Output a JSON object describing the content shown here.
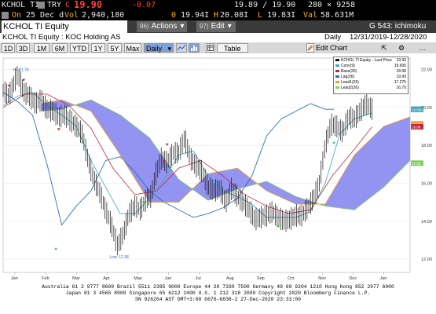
{
  "colors": {
    "bg": "#000000",
    "cloud": "#8080ee",
    "conv": "#3aa8b8",
    "base": "#c0283a",
    "lag": "#2a6fc0",
    "lead1": "#f0a030",
    "lead2": "#80d060",
    "price": "#111111",
    "quote_red": "#ff4040",
    "quote_amber": "#f0b030",
    "quote_white": "#e8e8e8"
  },
  "quote": {
    "ticker": "KCHOL TI",
    "currency": "TRY",
    "change_marker": "C",
    "last": "19.90",
    "change": "-0.07",
    "range": "19.89 / 19.90",
    "size": "280 × 9258",
    "as_of_label": "On",
    "date": "25 Dec d",
    "volume_label": "Vol",
    "volume": "2,940,180",
    "open_marker": "0",
    "open": "19.94I",
    "high_marker": "H",
    "high": "20.08I",
    "low_marker": "L",
    "low": "19.83I",
    "valuation_marker": "Val",
    "valuation": "58.631M"
  },
  "titlebar": {
    "security": "KCHOL TI Equity",
    "actions_num": "96)",
    "actions": "Actions",
    "edit_num": "97)",
    "edit": "Edit",
    "page": "G 543: ichimoku"
  },
  "subbar": {
    "name": "KCHOL TI Equity : KOC Holding AS",
    "period": "Daily",
    "range": "12/31/2019-12/28/2020"
  },
  "toolbar": {
    "ranges": [
      "1D",
      "3D",
      "1M",
      "6M",
      "YTD",
      "1Y",
      "5Y",
      "Max"
    ],
    "frequency": "Daily",
    "table": "Table",
    "edit_chart": "Edit Chart"
  },
  "chart_data": {
    "type": "line",
    "title": "",
    "x_ticks": [
      "Jan",
      "Feb",
      "Mar",
      "Apr",
      "May",
      "Jun",
      "Jul",
      "Aug",
      "Sep",
      "Oct",
      "Nov",
      "Dec",
      "Jan"
    ],
    "x_year_labels": [
      "2020",
      "2021"
    ],
    "y_ticks": [
      "22.00",
      "20.00",
      "18.00",
      "16.00",
      "14.00",
      "12.00"
    ],
    "ylim": [
      11.3,
      22.6
    ],
    "annotations": {
      "high": "Hi: 21.76",
      "low": "Low: 12.38"
    },
    "price_tags": [
      "19.90",
      "19.895",
      "19.132",
      "18.98",
      "17.06"
    ],
    "legend": [
      {
        "label": "KCHOL TI Equity - Last Price",
        "value": "19.90"
      },
      {
        "label": "Conv(9)",
        "value": "19.695"
      },
      {
        "label": "Base(26)",
        "value": "18.98"
      },
      {
        "label": "Lag(26)",
        "value": "19.90"
      },
      {
        "label": "Lead1(26)",
        "value": "17.275"
      },
      {
        "label": "Lead2(26)",
        "value": "16.70"
      }
    ],
    "series": [
      {
        "name": "KCHOL TI Equity - Last Price",
        "x": [
          0,
          4,
          8,
          10,
          14,
          18,
          22,
          26,
          30,
          34,
          38,
          42,
          46,
          50,
          54,
          58,
          62,
          66,
          70,
          74,
          78,
          82,
          86,
          90,
          94,
          98,
          101,
          104,
          108,
          112,
          116,
          120,
          124,
          128,
          132,
          136,
          140,
          144,
          148,
          152,
          156,
          160,
          164,
          168,
          172,
          176,
          180,
          184,
          188,
          192,
          196,
          200,
          204,
          208,
          212,
          216,
          220,
          224,
          228,
          232,
          236,
          240,
          244,
          248,
          252
        ],
        "y": [
          20.9,
          20.6,
          21.4,
          21.76,
          20.8,
          20.6,
          20.2,
          20.4,
          19.9,
          19.8,
          19.5,
          19.6,
          19.3,
          19.0,
          18.6,
          17.2,
          16.2,
          15.5,
          14.6,
          13.8,
          12.7,
          13.3,
          14.4,
          14.8,
          14.6,
          15.2,
          15.3,
          16.4,
          17.3,
          17.1,
          17.6,
          17.6,
          18.4,
          17.3,
          16.9,
          16.6,
          15.8,
          15.6,
          15.7,
          15.0,
          15.7,
          15.3,
          15.0,
          14.6,
          14.1,
          14.2,
          14.3,
          14.5,
          14.2,
          14.0,
          14.1,
          14.3,
          14.3,
          14.7,
          15.2,
          16.0,
          18.0,
          19.1,
          19.0,
          18.7,
          19.5,
          19.4,
          19.8,
          20.2,
          19.9
        ]
      },
      {
        "name": "Conv(9)",
        "x": [
          0,
          10,
          20,
          30,
          40,
          50,
          60,
          70,
          80,
          90,
          100,
          110,
          120,
          130,
          140,
          150,
          160,
          170,
          180,
          190,
          200,
          210,
          220,
          230,
          240,
          252
        ],
        "y": [
          20.1,
          20.6,
          20.8,
          20.1,
          19.6,
          19.0,
          17.2,
          15.8,
          14.4,
          14.4,
          15.2,
          16.2,
          17.5,
          17.7,
          16.4,
          15.6,
          15.3,
          14.9,
          14.2,
          14.2,
          14.2,
          14.5,
          16.0,
          18.6,
          19.4,
          19.7
        ]
      },
      {
        "name": "Base(26)",
        "x": [
          0,
          15,
          30,
          45,
          60,
          75,
          90,
          105,
          120,
          135,
          150,
          165,
          180,
          195,
          210,
          225,
          240,
          252
        ],
        "y": [
          20.0,
          20.7,
          20.7,
          20.1,
          18.9,
          16.8,
          15.4,
          15.6,
          16.8,
          17.2,
          16.4,
          15.4,
          14.8,
          14.4,
          14.6,
          16.4,
          17.8,
          18.98
        ]
      },
      {
        "name": "Lag(26)",
        "x": [
          0,
          10,
          20,
          30,
          40,
          50,
          60,
          70,
          80,
          90,
          100,
          110,
          120,
          130,
          140,
          150,
          160,
          170,
          180,
          190,
          200,
          210,
          220,
          226
        ],
        "y": [
          20.8,
          20.3,
          19.6,
          17.0,
          13.8,
          14.8,
          15.6,
          17.2,
          17.4,
          16.6,
          15.6,
          15.0,
          14.6,
          14.2,
          14.4,
          14.7,
          15.2,
          16.4,
          18.5,
          19.4,
          19.8,
          20.2,
          19.9,
          19.9
        ]
      },
      {
        "name": "Lead1(26)",
        "x": [
          26,
          40,
          60,
          80,
          100,
          120,
          140,
          160,
          180,
          200,
          220,
          240,
          260,
          278
        ],
        "y": [
          20.2,
          20.4,
          19.8,
          17.5,
          15.0,
          15.0,
          16.5,
          16.8,
          15.6,
          14.9,
          14.9,
          17.5,
          19.0,
          19.5
        ]
      },
      {
        "name": "Lead2(26)",
        "x": [
          26,
          40,
          60,
          80,
          100,
          120,
          140,
          160,
          180,
          200,
          220,
          240,
          260,
          278
        ],
        "y": [
          19.8,
          19.9,
          20.4,
          19.6,
          18.4,
          16.2,
          15.1,
          15.7,
          16.1,
          15.3,
          14.8,
          14.6,
          15.8,
          17.2
        ]
      }
    ]
  },
  "footer": {
    "line1": "Australia 61 2 9777 8600 Brazil 5511 2395 9000 Europe 44 20 7330 7500 Germany 49 69 9204 1210 Hong Kong 852 2977 6000",
    "line2": "Japan 81 3 4565 8900 Singapore 65 6212 1000 U.S. 1 212 318 2000 Copyright 2020 Bloomberg Finance L.P.",
    "line3": "SN 926264 AST GMT+3:00 G676-6838-2 27-Dec-2020 23:33:00"
  }
}
